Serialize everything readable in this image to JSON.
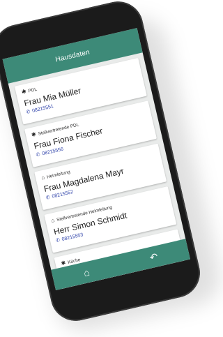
{
  "header": {
    "title": "Hausdaten"
  },
  "contacts": [
    {
      "role": "PDL",
      "role_icon": "asterisk-icon",
      "name": "Frau Mia Müller",
      "phone": "08215551"
    },
    {
      "role": "Stellvertretende PDL",
      "role_icon": "asterisk-icon",
      "name": "Frau Fiona Fischer",
      "phone": "08215556"
    },
    {
      "role": "Heimleitung",
      "role_icon": "home-icon",
      "name": "Frau Magdalena Mayr",
      "phone": "08215552"
    },
    {
      "role": "Stellvertretende Heimleitung",
      "role_icon": "home-icon",
      "name": "Herr Simon Schmidt",
      "phone": "08215553"
    },
    {
      "role": "Küche",
      "role_icon": "cutlery-icon",
      "name": "",
      "phone": ""
    }
  ],
  "bottom_nav": {
    "home_icon": "home-icon",
    "back_icon": "undo-icon"
  },
  "colors": {
    "accent": "#3d8a78",
    "phone_link": "#2b3fa8"
  }
}
